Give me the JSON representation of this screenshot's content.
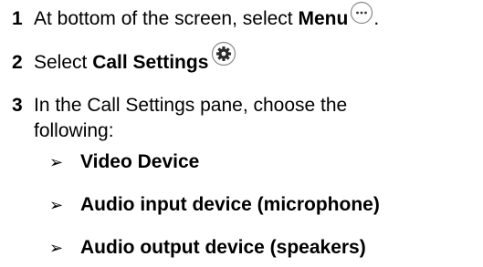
{
  "steps": [
    {
      "number": "1",
      "text_before": "At bottom of the screen, select ",
      "bold": "Menu",
      "text_after": ".",
      "icon": "more-options-circle-icon"
    },
    {
      "number": "2",
      "text_before": "Select ",
      "bold": "Call Settings",
      "icon": "gear-circle-icon"
    },
    {
      "number": "3",
      "line1": "In the Call Settings pane, choose the",
      "line2": "following:"
    }
  ],
  "options": [
    {
      "marker": "➢",
      "label": "Video Device"
    },
    {
      "marker": "➢",
      "label": "Audio input device (microphone)"
    },
    {
      "marker": "➢",
      "label": "Audio output device (speakers)"
    }
  ]
}
